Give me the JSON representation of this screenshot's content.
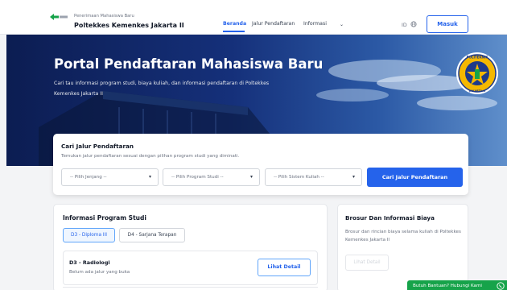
{
  "header": {
    "brand_sub": "Penerimaan Mahasiswa Baru",
    "brand_main": "Poltekkes Kemenkes Jakarta II",
    "nav": [
      {
        "label": "Beranda"
      },
      {
        "label": "Jalur Pendaftaran"
      },
      {
        "label": "Informasi"
      }
    ],
    "lang_label": "ID",
    "login_label": "Masuk"
  },
  "hero": {
    "title": "Portal Pendaftaran Mahasiswa Baru",
    "description": "Cari tau informasi program studi, biaya kuliah, dan informasi pendaftaran di Poltekkes Kemenkes Jakarta II",
    "emblem_text": "POLITEKNIK KESEHATAN KEMENKES JAKARTA II"
  },
  "search": {
    "title": "Cari Jalur Pendaftaran",
    "description": "Temukan jalur pendaftaran sesuai dengan pilihan program studi yang diminati.",
    "selects": [
      {
        "placeholder": "-- Pilih Jenjang --"
      },
      {
        "placeholder": "-- Pilih Program Studi --"
      },
      {
        "placeholder": "-- Pilih Sistem Kuliah --"
      }
    ],
    "button_label": "Cari Jalur Pendaftaran"
  },
  "programs": {
    "title": "Informasi Program Studi",
    "tabs": [
      {
        "label": "D3 - Diploma III",
        "active": true
      },
      {
        "label": "D4 - Sarjana Terapan",
        "active": false
      }
    ],
    "items": [
      {
        "name": "D3 - Radiologi",
        "status": "Belum ada jalur yang buka",
        "button_label": "Lihat Detail"
      }
    ]
  },
  "brochure": {
    "title": "Brosur Dan Informasi Biaya",
    "description": "Brosur dan rincian biaya selama kuliah di Poltekkes Kemenkes Jakarta II",
    "button_label": "Lihat Detail"
  },
  "help": {
    "label": "Butuh Bantuan? Hubungi Kami"
  },
  "colors": {
    "primary": "#2563eb",
    "hero_dark": "#0c1d52",
    "help_green": "#16a34a"
  }
}
